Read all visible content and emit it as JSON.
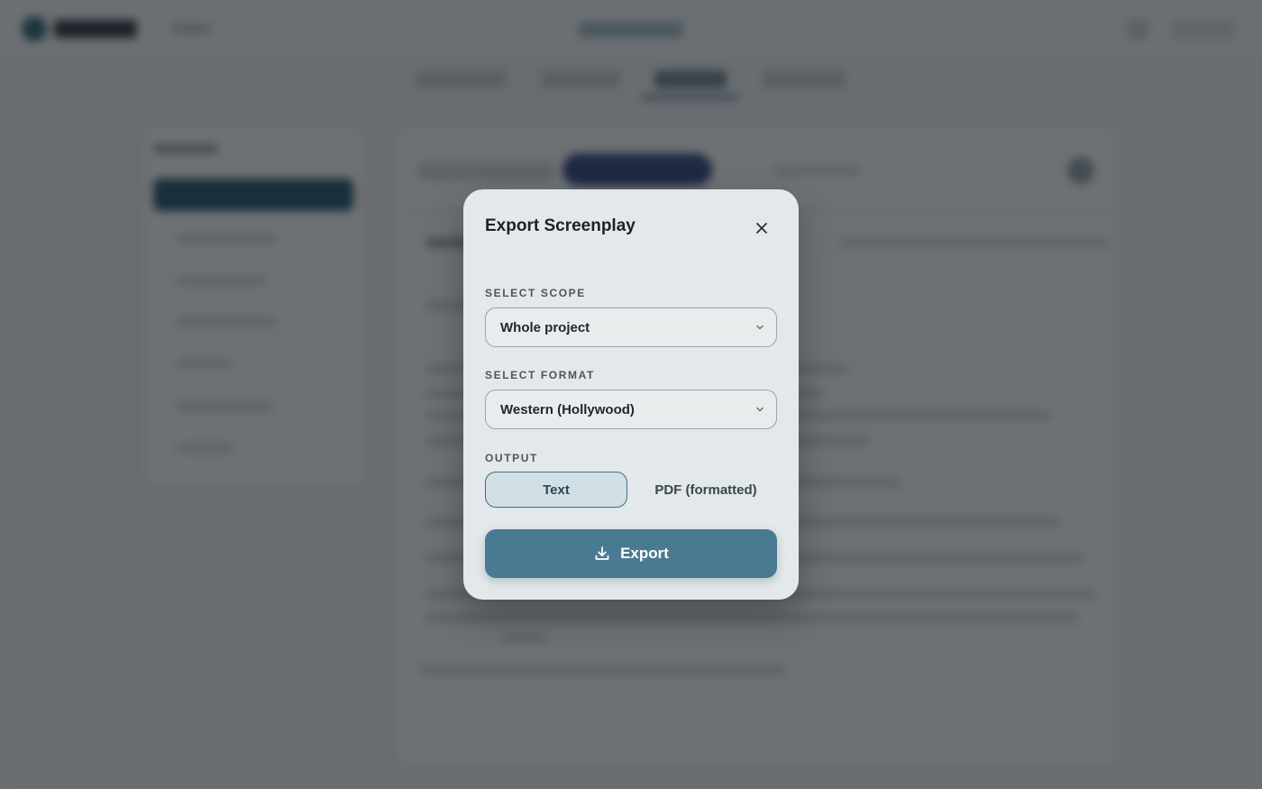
{
  "modal": {
    "title": "Export Screenplay",
    "scope_label": "SELECT SCOPE",
    "scope_value": "Whole project",
    "format_label": "SELECT FORMAT",
    "format_value": "Western (Hollywood)",
    "output_label": "OUTPUT",
    "output_options": [
      "Text",
      "PDF (formatted)"
    ],
    "output_selected": "Text",
    "export_label": "Export"
  },
  "icons": {
    "close": "close-icon",
    "chevron": "chevron-down-icon",
    "download": "download-icon"
  },
  "colors": {
    "accent": "#4a7a91",
    "modal_bg": "#e3e8ea",
    "segment_active_bg": "#d2dfe4",
    "overlay": "#161c20"
  }
}
